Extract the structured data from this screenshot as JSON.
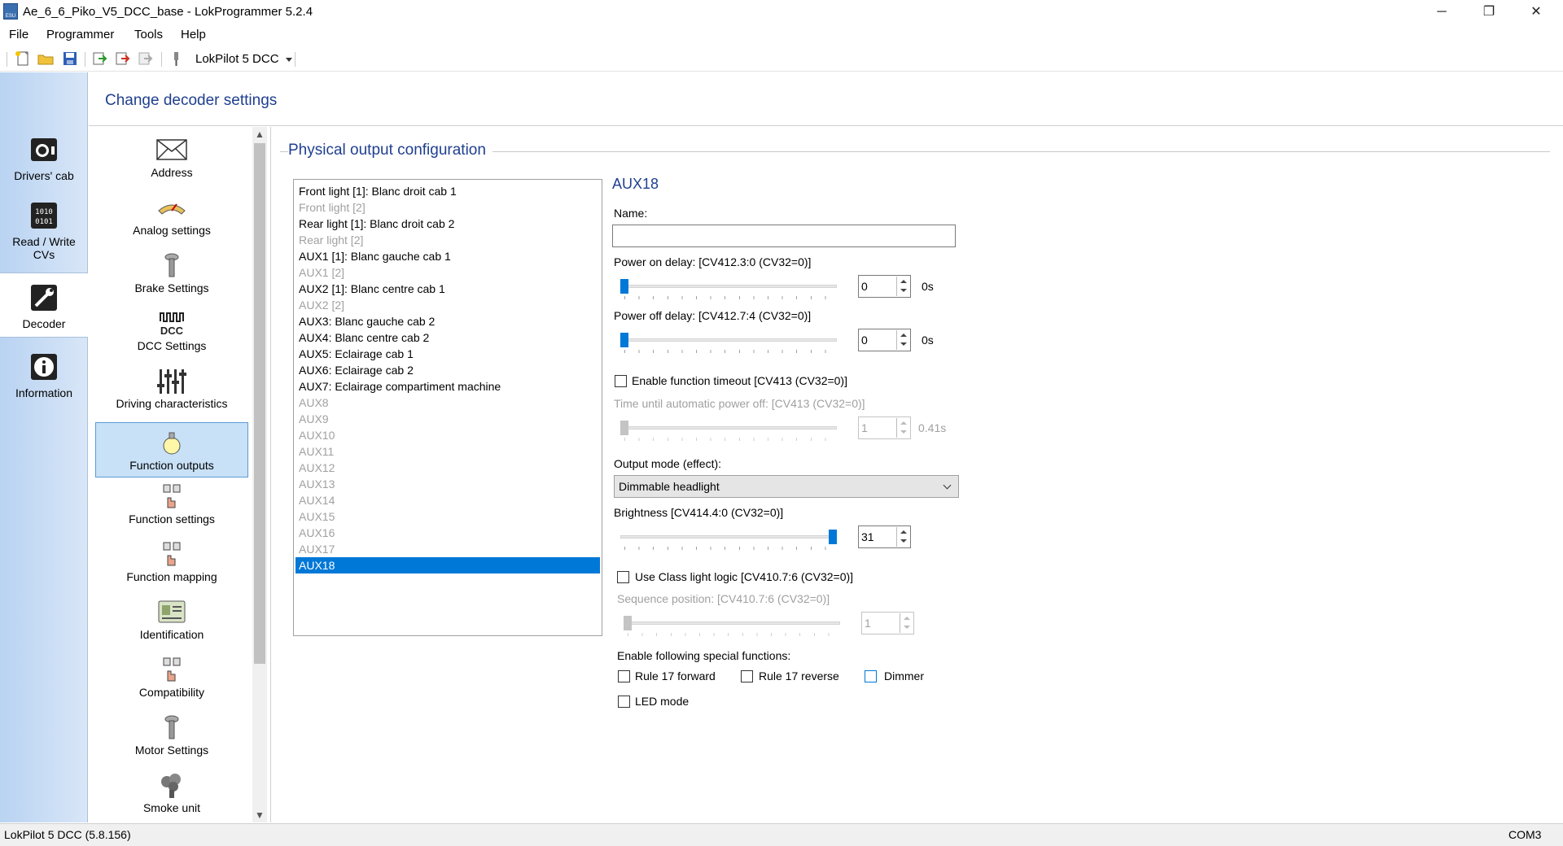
{
  "window": {
    "title": "Ae_6_6_Piko_V5_DCC_base - LokProgrammer 5.2.4",
    "minimize": "─",
    "maximize": "❐",
    "close": "✕"
  },
  "menu": [
    "File",
    "Programmer",
    "Tools",
    "Help"
  ],
  "toolbar": {
    "decoder_select": "LokPilot 5 DCC",
    "icons": [
      "new-file-icon",
      "open-folder-icon",
      "save-icon",
      "read-decoder-icon",
      "write-decoder-icon",
      "write-disabled-icon",
      "programmer-tool-icon"
    ]
  },
  "left_nav": [
    {
      "label": "Drivers' cab",
      "icon": "drivers-cab-icon"
    },
    {
      "label": "Read / Write CVs",
      "icon": "read-write-cvs-icon"
    },
    {
      "label": "Decoder",
      "icon": "decoder-wrench-icon",
      "active": true
    },
    {
      "label": "Information",
      "icon": "information-icon"
    }
  ],
  "header": {
    "title": "Change decoder settings"
  },
  "settings_list": [
    {
      "label": "Address",
      "icon": "envelope-icon"
    },
    {
      "label": "Analog settings",
      "icon": "analog-gauge-icon"
    },
    {
      "label": "Brake Settings",
      "icon": "brake-icon"
    },
    {
      "label": "DCC Settings",
      "icon": "dcc-icon"
    },
    {
      "label": "Driving characteristics",
      "icon": "sliders-icon"
    },
    {
      "label": "Function outputs",
      "icon": "lightbulb-icon",
      "active": true
    },
    {
      "label": "Function settings",
      "icon": "function-keys-icon"
    },
    {
      "label": "Function mapping",
      "icon": "function-keys-icon"
    },
    {
      "label": "Identification",
      "icon": "id-card-icon"
    },
    {
      "label": "Compatibility",
      "icon": "function-keys-icon"
    },
    {
      "label": "Motor Settings",
      "icon": "motor-icon"
    },
    {
      "label": "Smoke unit",
      "icon": "smoke-icon"
    }
  ],
  "content": {
    "section_title": "Physical output configuration",
    "outputs": [
      {
        "label": "Front light [1]: Blanc droit cab 1",
        "dim": false
      },
      {
        "label": "Front light [2]",
        "dim": true
      },
      {
        "label": "Rear light [1]: Blanc droit cab 2",
        "dim": false
      },
      {
        "label": "Rear light [2]",
        "dim": true
      },
      {
        "label": "AUX1 [1]: Blanc gauche cab 1",
        "dim": false
      },
      {
        "label": "AUX1 [2]",
        "dim": true
      },
      {
        "label": "AUX2 [1]: Blanc centre cab 1",
        "dim": false
      },
      {
        "label": "AUX2 [2]",
        "dim": true
      },
      {
        "label": "AUX3: Blanc gauche cab 2",
        "dim": false
      },
      {
        "label": "AUX4: Blanc centre cab 2",
        "dim": false
      },
      {
        "label": "AUX5: Eclairage cab 1",
        "dim": false
      },
      {
        "label": "AUX6: Eclairage cab 2",
        "dim": false
      },
      {
        "label": "AUX7: Eclairage compartiment machine",
        "dim": false
      },
      {
        "label": "AUX8",
        "dim": true
      },
      {
        "label": "AUX9",
        "dim": true
      },
      {
        "label": "AUX10",
        "dim": true
      },
      {
        "label": "AUX11",
        "dim": true
      },
      {
        "label": "AUX12",
        "dim": true
      },
      {
        "label": "AUX13",
        "dim": true
      },
      {
        "label": "AUX14",
        "dim": true
      },
      {
        "label": "AUX15",
        "dim": true
      },
      {
        "label": "AUX16",
        "dim": true
      },
      {
        "label": "AUX17",
        "dim": true
      },
      {
        "label": "AUX18",
        "dim": false,
        "selected": true
      }
    ],
    "detail": {
      "title": "AUX18",
      "name_label": "Name:",
      "name_value": "",
      "power_on_label": "Power on delay: [CV412.3:0 (CV32=0)]",
      "power_on_value": "0",
      "power_on_unit": "0s",
      "power_on_level": 0,
      "power_off_label": "Power off delay: [CV412.7:4 (CV32=0)]",
      "power_off_value": "0",
      "power_off_unit": "0s",
      "power_off_level": 0,
      "timeout_check_label": "Enable function timeout [CV413 (CV32=0)]",
      "timeout_label": "Time until automatic power off: [CV413 (CV32=0)]",
      "timeout_value": "1",
      "timeout_unit": "0.41s",
      "timeout_level": 0,
      "output_mode_label": "Output mode (effect):",
      "output_mode_value": "Dimmable headlight",
      "brightness_label": "Brightness [CV414.4:0 (CV32=0)]",
      "brightness_value": "31",
      "brightness_level": 1.0,
      "class_light_label": "Use Class light logic [CV410.7:6 (CV32=0)]",
      "sequence_label": "Sequence position: [CV410.7:6 (CV32=0)]",
      "sequence_value": "1",
      "sequence_level": 0,
      "special_label": "Enable following special functions:",
      "rule17_fwd": "Rule 17 forward",
      "rule17_rev": "Rule 17 reverse",
      "dimmer": "Dimmer",
      "led_mode": "LED mode"
    }
  },
  "status": {
    "left": "LokPilot 5 DCC (5.8.156)",
    "right": "COM3"
  }
}
